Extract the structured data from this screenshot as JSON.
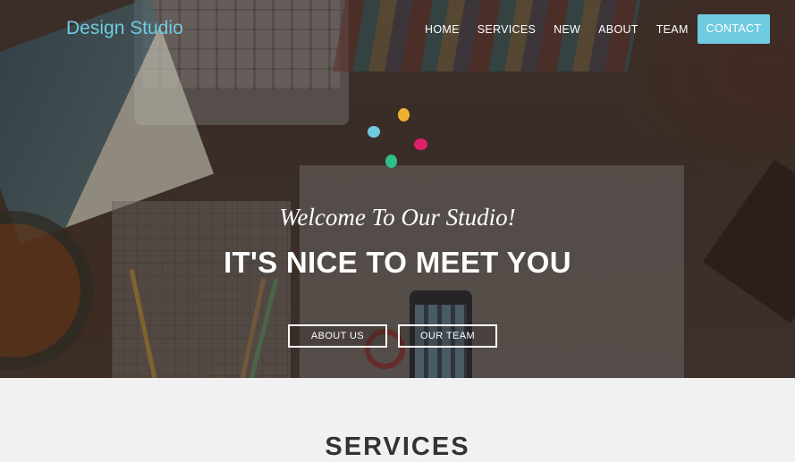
{
  "header": {
    "brand": "Design Studio",
    "nav": [
      {
        "label": "HOME",
        "active": false
      },
      {
        "label": "SERVICES",
        "active": false
      },
      {
        "label": "NEW",
        "active": false
      },
      {
        "label": "ABOUT",
        "active": false
      },
      {
        "label": "TEAM",
        "active": false
      },
      {
        "label": "CONTACT",
        "active": true
      }
    ]
  },
  "hero": {
    "subtitle": "Welcome To Our Studio!",
    "title": "IT'S NICE TO MEET YOU",
    "buttons": {
      "about_us": "ABOUT US",
      "our_team": "OUR TEAM"
    },
    "loader_dots": [
      "#f0b030",
      "#6fcbe0",
      "#e0206a",
      "#2fbf8a"
    ]
  },
  "services": {
    "heading": "SERVICES"
  },
  "colors": {
    "accent": "#6fcbe0",
    "section_bg": "#f1f1f1"
  }
}
